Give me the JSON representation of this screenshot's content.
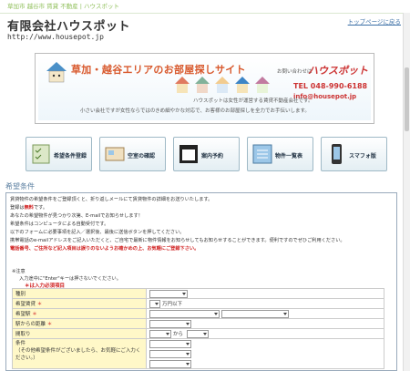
{
  "breadcrumb": "草加市 越谷市 賃貸 不動産 | ハウスポット",
  "header": {
    "company": "有限会社ハウスポット",
    "url": "http://www.housepot.jp",
    "top_link": "トップページに戻る"
  },
  "banner": {
    "title": "草加・越谷エリアのお部屋探しサイト",
    "contact_label": "お問い合わせは",
    "logo": "ハウスポット",
    "tel": "TEL 048-990-6188",
    "mail": "info@housepot.jp",
    "sub1": "ハウスポットは女性が運営する賃貸不動産会社です。",
    "sub2": "小さい会社ですが女性ならではのきめ細やかな対応で、お客様のお部屋探しを全力でお手伝いします。"
  },
  "nav": [
    {
      "label": "希望条件登録",
      "icon": "checklist-icon"
    },
    {
      "label": "空室の確認",
      "icon": "room-icon"
    },
    {
      "label": "案内予約",
      "icon": "calendar-icon"
    },
    {
      "label": "物件一覧表",
      "icon": "list-icon"
    },
    {
      "label": "スマフォ版",
      "icon": "smartphone-icon"
    }
  ],
  "section_title": "希望条件",
  "intro": {
    "line1": "賃貸物件の希望条件をご登録頂くと、折り返しメールにて賃貸物件の詳細をお送りいたします。",
    "line2_prefix": "登録は",
    "line2_red": "無料",
    "line2_suffix": "です。",
    "line3": "あなたの希望物件が見つかり次第、E-mailでお知らせします！",
    "line4": "希望条件はコンピュータによる自動受付です。",
    "line5": "以下のフォームに必要事項を記入／選択後、最後に送信ボタンを押してください。",
    "line6": "携帯電話のe-mailアドレスをご記入いただくと、ご自宅で最新に物件情報をお知らせしてもお知らせすることができます。便利ですのでぜひご利用ください。",
    "warning": "電話番号、ご住所など記入項目は誤りのないようお確かめの上、お気軽にご登録下さい。"
  },
  "notes": {
    "title": "※注意",
    "line1": "入力途中に\"Enter\"キーは押さないでください。",
    "required": "＊は入力必須項目"
  },
  "form": {
    "rows": [
      {
        "label": "種別",
        "required": false
      },
      {
        "label": "希望賃貸",
        "required": true,
        "suffix": "万円以下"
      },
      {
        "label": "希望駅",
        "required": true
      },
      {
        "label": "駅からの距離",
        "required": true
      },
      {
        "label": "間取り",
        "required": false,
        "suffix": "から"
      },
      {
        "label": "条件",
        "required": false
      },
      {
        "label": "（その他希望条件がございましたら、お気軽にご入力ください。）",
        "required": false
      }
    ]
  }
}
